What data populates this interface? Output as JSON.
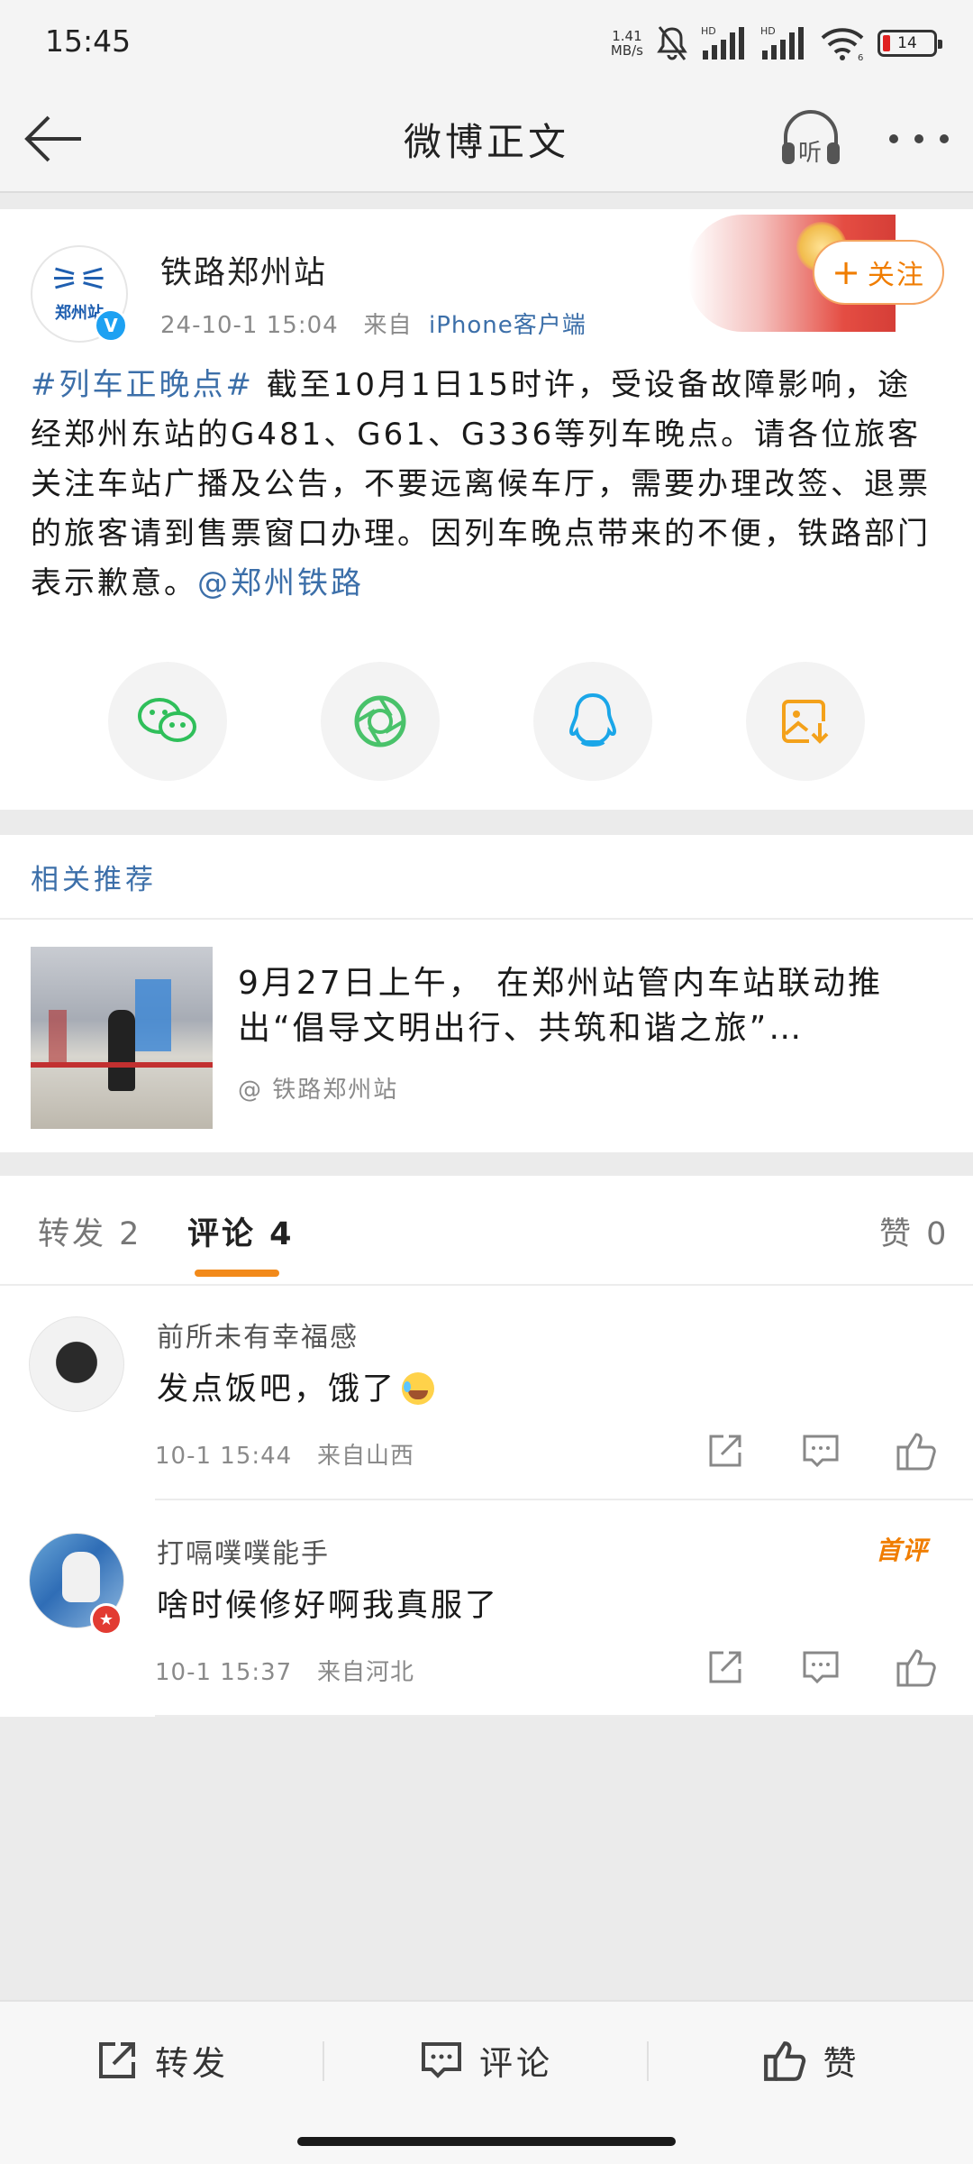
{
  "status_bar": {
    "time": "15:45",
    "net_speed_value": "1.41",
    "net_speed_unit": "MB/s",
    "battery": "14",
    "signal_labels": [
      "HD",
      "HD"
    ],
    "wifi_sub": "6"
  },
  "nav": {
    "title": "微博正文",
    "listen_label": "听"
  },
  "post": {
    "author": "铁路郑州站",
    "avatar_text": "郑州站",
    "verified_mark": "V",
    "time": "24-10-1 15:04",
    "source_prefix": "来自",
    "source": "iPhone客户端",
    "follow_label": "关注",
    "topic": "#列车正晚点#",
    "body": " 截至10月1日15时许，受设备故障影响，途经郑州东站的G481、G61、G336等列车晚点。请各位旅客关注车站广播及公告，不要远离候车厅，需要办理改签、退票的旅客请到售票窗口办理。因列车晚点带来的不便，铁路部门表示歉意。",
    "mention": "@郑州铁路"
  },
  "share_buttons": [
    "wechat-icon",
    "moments-icon",
    "qq-icon",
    "save-image-icon"
  ],
  "related": {
    "heading": "相关推荐",
    "title": "9月27日上午， 在郑州站管内车站联动推出“倡导文明出行、共筑和谐之旅”…",
    "source": "@ 铁路郑州站"
  },
  "tabs": {
    "repost": "转发 2",
    "comment": "评论 4",
    "like": "赞 0"
  },
  "comments": [
    {
      "name": "前所未有幸福感",
      "text": "发点饭吧，饿了",
      "time": "10-1 15:44",
      "location": "来自山西"
    },
    {
      "name": "打嗝噗噗能手",
      "text": "啥时候修好啊我真服了",
      "time": "10-1 15:37",
      "location": "来自河北",
      "badge": "首评"
    }
  ],
  "bottom_bar": {
    "repost": "转发",
    "comment": "评论",
    "like": "赞"
  },
  "colors": {
    "link": "#3c6fa9",
    "accent": "#f07d00",
    "tab_indicator": "#f28a1a"
  }
}
